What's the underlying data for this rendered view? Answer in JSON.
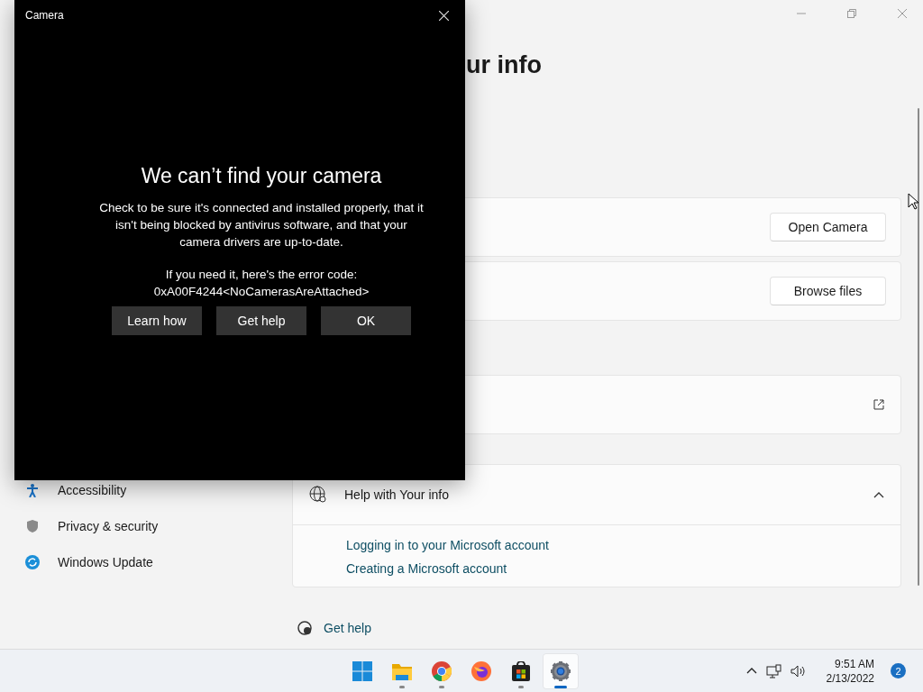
{
  "settings_window": {
    "title": "ur info",
    "sidebar": {
      "items": [
        {
          "label": "Accessibility",
          "kind": "accessibility"
        },
        {
          "label": "Privacy & security",
          "kind": "shield"
        },
        {
          "label": "Windows Update",
          "kind": "update"
        }
      ]
    },
    "cards": [
      {
        "kind": "button",
        "button": "Open Camera"
      },
      {
        "kind": "button",
        "button": "Browse files"
      },
      {
        "kind": "external"
      }
    ],
    "help": {
      "title": "Help with Your info",
      "expanded": true,
      "links": [
        "Logging in to your Microsoft account",
        "Creating a Microsoft account"
      ]
    },
    "get_help": "Get help"
  },
  "camera_dialog": {
    "title": "Camera",
    "heading": "We can’t find your camera",
    "message": "Check to be sure it's connected and installed properly, that it isn't being blocked by antivirus software, and that your camera drivers are up-to-date.",
    "error_label": "If you need it, here's the error code:",
    "error_code": "0xA00F4244<NoCamerasAreAttached>",
    "buttons": [
      "Learn how",
      "Get help",
      "OK"
    ]
  },
  "taskbar": {
    "apps": [
      {
        "kind": "start",
        "running": false,
        "active": false
      },
      {
        "kind": "folder",
        "running": true,
        "active": false
      },
      {
        "kind": "chrome",
        "running": true,
        "active": false
      },
      {
        "kind": "firefox",
        "running": false,
        "active": false
      },
      {
        "kind": "store",
        "running": true,
        "active": false
      },
      {
        "kind": "settings",
        "running": true,
        "active": true
      }
    ],
    "time": "9:51 AM",
    "date": "2/13/2022",
    "notifications": "2"
  }
}
